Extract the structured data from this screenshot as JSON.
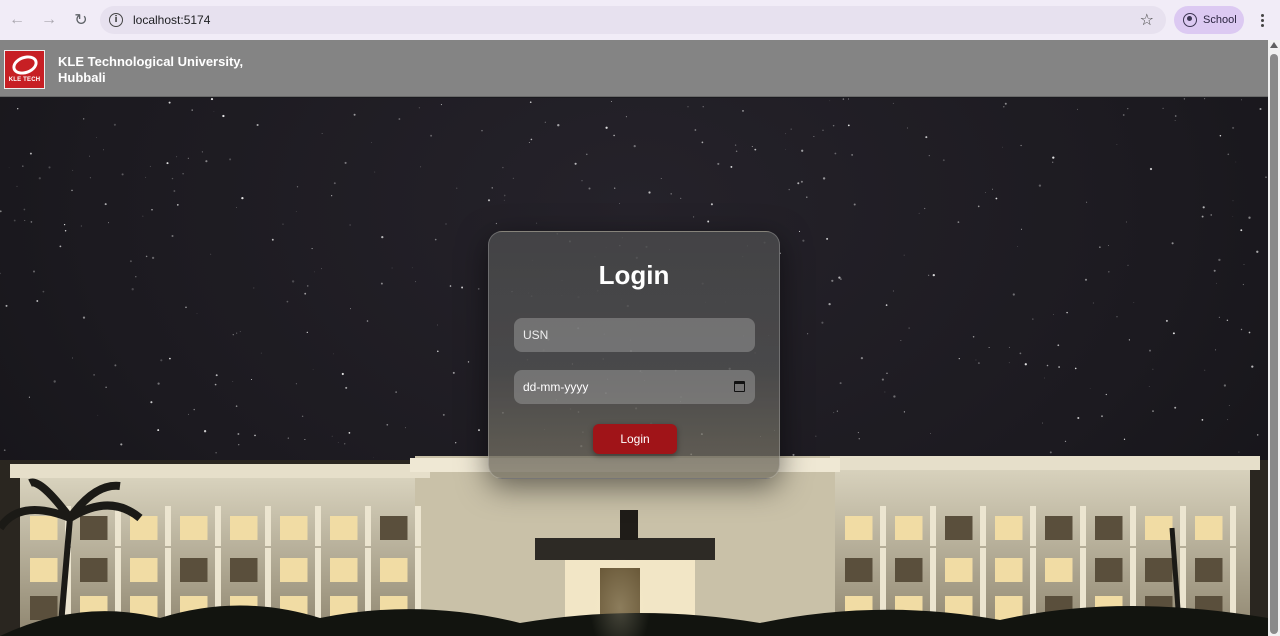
{
  "browser": {
    "url": "localhost:5174",
    "profile_label": "School"
  },
  "header": {
    "logo_text": "KLE TECH",
    "brand_name": "KLE Technological University, Hubbali"
  },
  "login": {
    "title": "Login",
    "usn_placeholder": "USN",
    "dob_placeholder": "dd-mm-yyyy",
    "button_label": "Login"
  },
  "colors": {
    "header_bg": "#848484",
    "button_bg": "#a01418",
    "logo_bg": "#c71f24",
    "browser_chrome": "#f1ecf7"
  },
  "icons": {
    "back": "back-arrow-icon",
    "forward": "forward-arrow-icon",
    "reload": "reload-icon",
    "site_info": "info-icon",
    "bookmark": "star-icon",
    "profile": "profile-icon",
    "menu": "kebab-menu-icon",
    "calendar": "calendar-icon"
  }
}
